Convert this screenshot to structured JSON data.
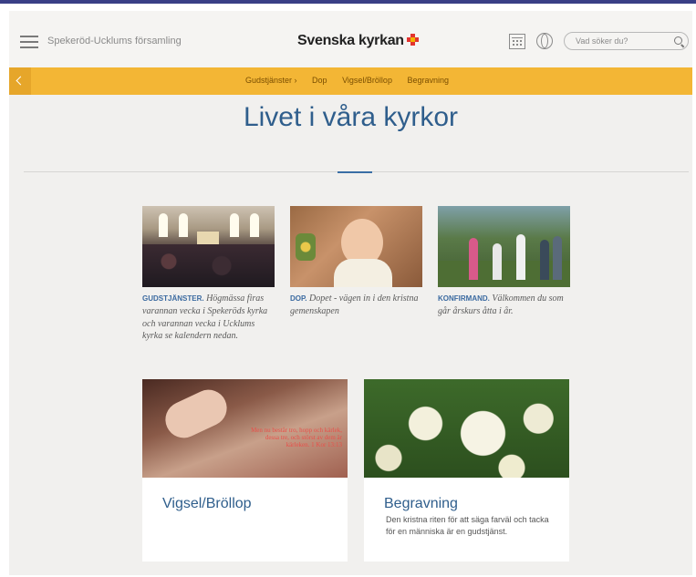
{
  "header": {
    "parish": "Spekeröd-Ucklums församling",
    "brand": "Svenska kyrkan",
    "search_placeholder": "Vad söker du?"
  },
  "nav": {
    "items": [
      "Gudstjänster",
      "Dop",
      "Vigsel/Bröllop",
      "Begravning"
    ]
  },
  "main": {
    "title": "Livet i våra kyrkor",
    "cards": [
      {
        "label": "GUDSTJÄNSTER.",
        "text": "Högmässa firas varannan vecka i Spekeröds kyrka och varannan vecka i Ucklums kyrka se kalendern nedan."
      },
      {
        "label": "DOP.",
        "text": "Dopet - vägen in i den kristna gemenskapen"
      },
      {
        "label": "KONFIRMAND.",
        "text": "Välkommen du som går årskurs åtta i år."
      }
    ],
    "big_cards": [
      {
        "title": "Vigsel/Bröllop",
        "desc": "",
        "verse": "Men nu består tro, hopp och kärlek, dessa tre, och störst av dem är kärleken. 1 Kor 13:13"
      },
      {
        "title": "Begravning",
        "desc": "Den kristna riten för att säga farväl och tacka för en människa är en gudstjänst."
      }
    ]
  },
  "colors": {
    "accent_yellow": "#f3b635",
    "title_blue": "#2f5e8c",
    "brand_red": "#e2342f"
  },
  "icons": [
    "hamburger-icon",
    "calendar-icon",
    "globe-icon",
    "search-icon",
    "back-arrow-icon"
  ]
}
